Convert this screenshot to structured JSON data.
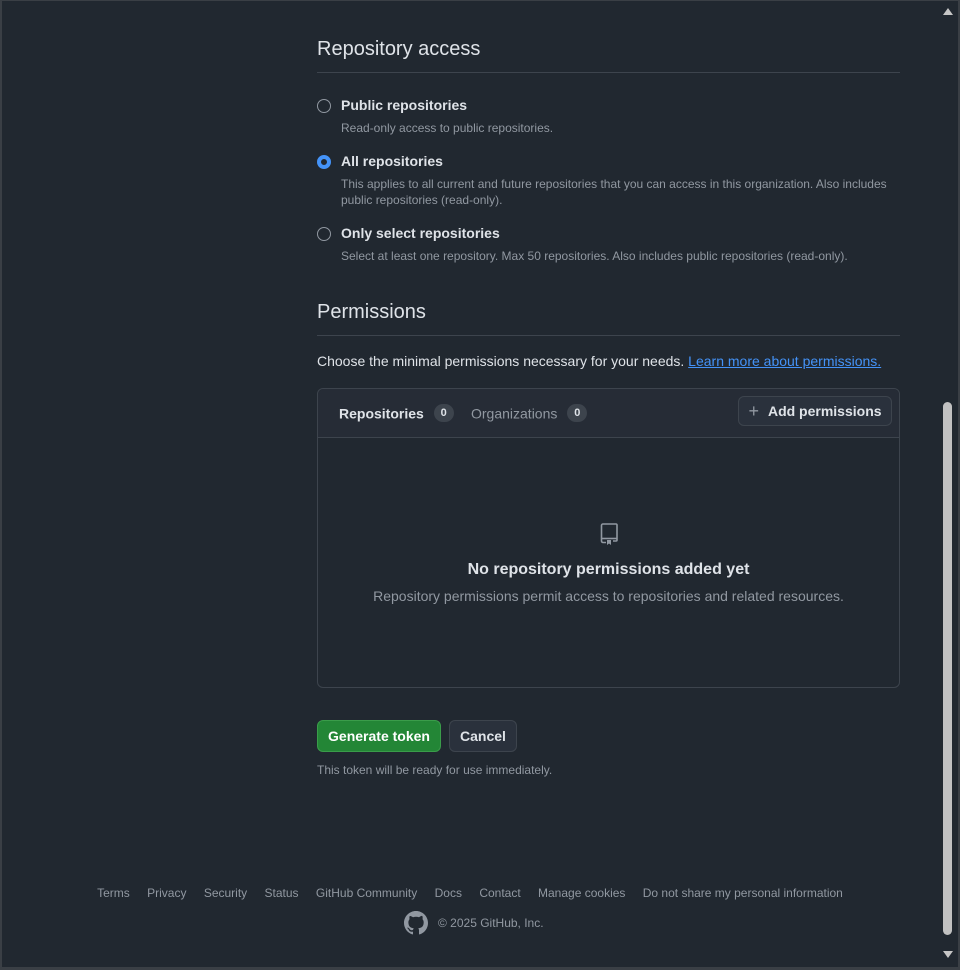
{
  "repository_access": {
    "title": "Repository access",
    "options": [
      {
        "label": "Public repositories",
        "description": "Read-only access to public repositories.",
        "checked": false
      },
      {
        "label": "All repositories",
        "description": "This applies to all current and future repositories that you can access in this organization. Also includes public repositories (read-only).",
        "checked": true
      },
      {
        "label": "Only select repositories",
        "description": "Select at least one repository. Max 50 repositories. Also includes public repositories (read-only).",
        "checked": false
      }
    ]
  },
  "permissions": {
    "title": "Permissions",
    "intro": "Choose the minimal permissions necessary for your needs.",
    "learn_more": "Learn more about permissions.",
    "tabs": [
      {
        "label": "Repositories",
        "count": "0"
      },
      {
        "label": "Organizations",
        "count": "0"
      }
    ],
    "add_button": "Add permissions",
    "empty_title": "No repository permissions added yet",
    "empty_desc": "Repository permissions permit access to repositories and related resources."
  },
  "actions": {
    "generate": "Generate token",
    "cancel": "Cancel",
    "note": "This token will be ready for use immediately."
  },
  "footer": {
    "links": [
      "Terms",
      "Privacy",
      "Security",
      "Status",
      "GitHub Community",
      "Docs",
      "Contact",
      "Manage cookies",
      "Do not share my personal information"
    ],
    "copyright": "© 2025 GitHub, Inc."
  },
  "colors": {
    "background": "#212830",
    "accent": "#4493f8",
    "primary_button": "#238636"
  },
  "icons": [
    "repo-icon",
    "plus-icon",
    "github-logo-icon",
    "scroll-up-icon",
    "scroll-down-icon"
  ]
}
